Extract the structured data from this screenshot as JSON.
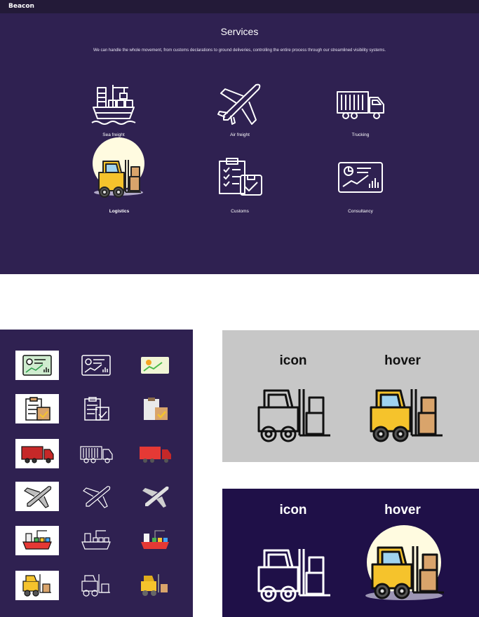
{
  "app": {
    "brand": "Beacon"
  },
  "hero": {
    "title": "Services",
    "subtitle": "We can handle the whole movement, from customs declarations to ground deliveries, controlling the entire process through our streamlined visibility systems."
  },
  "services": [
    {
      "label": "Sea freight",
      "icon": "ship-icon"
    },
    {
      "label": "Air freight",
      "icon": "airplane-icon"
    },
    {
      "label": "Trucking",
      "icon": "truck-icon"
    },
    {
      "label": "Logistics",
      "icon": "forklift-icon",
      "state": "hover"
    },
    {
      "label": "Customs",
      "icon": "clipboard-icon"
    },
    {
      "label": "Consultancy",
      "icon": "chart-board-icon"
    }
  ],
  "comparison": {
    "icon_label": "icon",
    "hover_label": "hover"
  },
  "colors": {
    "hero_bg": "#2f2151",
    "topbar_bg": "#231a38",
    "accent_yellow": "#f5c32c",
    "glow": "#fffbe0",
    "gray_panel": "#c7c7c7",
    "purple_panel": "#1f1048"
  }
}
